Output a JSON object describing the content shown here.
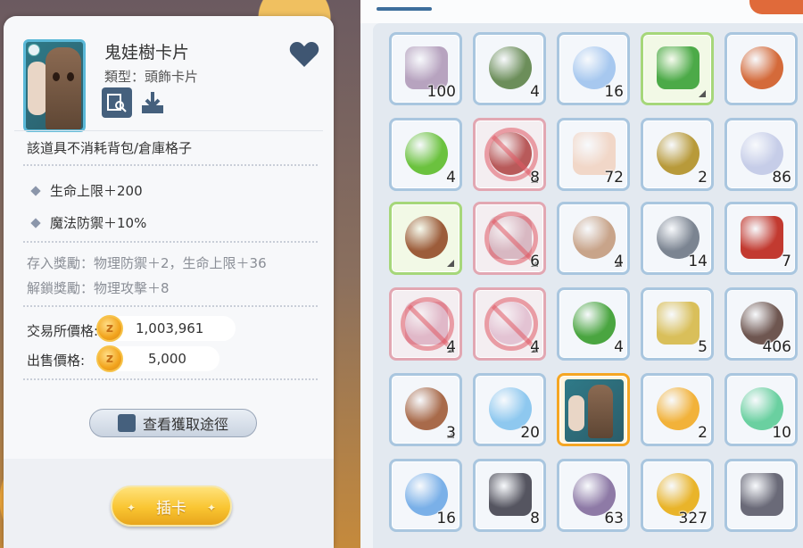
{
  "detail": {
    "name": "鬼娃樹卡片",
    "type": "類型：頭飾卡片",
    "note": "該道具不消耗背包/倉庫格子",
    "stats": [
      "生命上限＋200",
      "魔法防禦＋10%"
    ],
    "deposit_bonus": "存入獎勵：物理防禦＋2，生命上限＋36",
    "unlock_bonus": "解鎖獎勵：物理攻擊＋8",
    "exchange_label": "交易所價格:",
    "exchange_value": "1,003,961",
    "sell_label": "出售價格:",
    "sell_value": "5,000",
    "source_button": "查看獲取途徑",
    "insert_button": "插卡"
  },
  "colors": {
    "accent_blue": "#45607d",
    "slot_border": "#a9c6df",
    "selected_border": "#f5a623",
    "button_gold": "#f9c531"
  },
  "inventory": {
    "rows": [
      [
        {
          "icon": "book-icon",
          "count": "100",
          "state": "normal"
        },
        {
          "icon": "seed-icon",
          "count": "4",
          "state": "normal"
        },
        {
          "icon": "water-drop-icon",
          "count": "16",
          "state": "normal"
        },
        {
          "icon": "boots-icon",
          "count": "",
          "state": "green"
        },
        {
          "icon": "food-platter-icon",
          "count": "",
          "state": "normal"
        }
      ],
      [
        {
          "icon": "mortar-green-icon",
          "count": "4",
          "state": "normal"
        },
        {
          "icon": "dagger-icon",
          "count": "8",
          "state": "pink"
        },
        {
          "icon": "glove-icon",
          "count": "72",
          "state": "normal"
        },
        {
          "icon": "honeycomb-icon",
          "count": "2",
          "state": "normal"
        },
        {
          "icon": "crystal-icon",
          "count": "86",
          "state": "normal"
        }
      ],
      [
        {
          "icon": "cowboy-hat-icon",
          "count": "",
          "state": "green"
        },
        {
          "icon": "armor-icon",
          "count": "6",
          "state": "pink"
        },
        {
          "icon": "bow-icon",
          "count": "4",
          "state": "normal"
        },
        {
          "icon": "stone-icon",
          "count": "14",
          "state": "normal"
        },
        {
          "icon": "skull-potion-icon",
          "count": "7",
          "state": "normal"
        }
      ],
      [
        {
          "icon": "shield-icon",
          "count": "4",
          "state": "pink"
        },
        {
          "icon": "gauntlet-icon",
          "count": "4",
          "state": "pink"
        },
        {
          "icon": "green-bottle-icon",
          "count": "4",
          "state": "normal"
        },
        {
          "icon": "mortar-yellow-icon",
          "count": "5",
          "state": "normal"
        },
        {
          "icon": "leather-icon",
          "count": "406",
          "state": "normal"
        }
      ],
      [
        {
          "icon": "backpack-icon",
          "count": "3",
          "state": "normal"
        },
        {
          "icon": "ice-shard-icon",
          "count": "20",
          "state": "normal"
        },
        {
          "icon": "card-icon",
          "count": "",
          "state": "selected"
        },
        {
          "icon": "gold-crystal-icon",
          "count": "2",
          "state": "normal"
        },
        {
          "icon": "green-potion-icon",
          "count": "10",
          "state": "normal"
        }
      ],
      [
        {
          "icon": "blue-crystal-icon",
          "count": "16",
          "state": "normal"
        },
        {
          "icon": "iron-ore-icon",
          "count": "8",
          "state": "normal"
        },
        {
          "icon": "pebble-icon",
          "count": "63",
          "state": "normal"
        },
        {
          "icon": "gold-dust-icon",
          "count": "327",
          "state": "normal"
        },
        {
          "icon": "metal-shard-icon",
          "count": "",
          "state": "normal"
        }
      ]
    ]
  }
}
